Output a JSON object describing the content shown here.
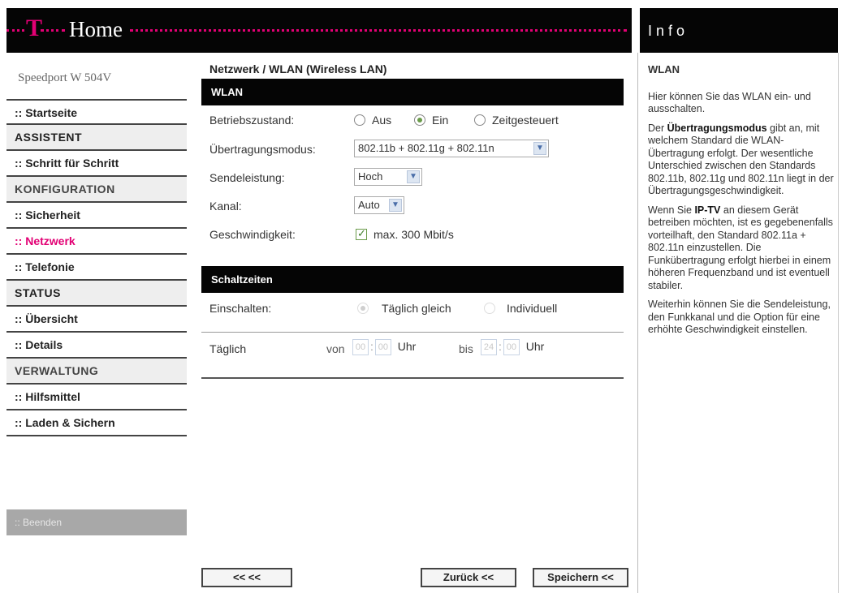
{
  "header": {
    "logo": "T",
    "title": "Home",
    "info_title": "Info"
  },
  "sidebar": {
    "device_name": "Speedport W 504V",
    "items": [
      {
        "label": ":: Startseite",
        "kind": "link"
      },
      {
        "label": "ASSISTENT",
        "kind": "section"
      },
      {
        "label": ":: Schritt für Schritt",
        "kind": "link"
      },
      {
        "label": "KONFIGURATION",
        "kind": "section"
      },
      {
        "label": ":: Sicherheit",
        "kind": "link"
      },
      {
        "label": ":: Netzwerk",
        "kind": "link",
        "active": true
      },
      {
        "label": ":: Telefonie",
        "kind": "link"
      },
      {
        "label": "STATUS",
        "kind": "section"
      },
      {
        "label": ":: Übersicht",
        "kind": "link"
      },
      {
        "label": ":: Details",
        "kind": "link"
      },
      {
        "label": "VERWALTUNG",
        "kind": "section"
      },
      {
        "label": ":: Hilfsmittel",
        "kind": "link"
      },
      {
        "label": ":: Laden & Sichern",
        "kind": "link"
      }
    ],
    "logout_label": ":: Beenden"
  },
  "main": {
    "breadcrumb": "Netzwerk / WLAN (Wireless LAN)",
    "wlan": {
      "section_title": "WLAN",
      "betriebszustand": {
        "label": "Betriebszustand:",
        "options": [
          "Aus",
          "Ein",
          "Zeitgesteuert"
        ],
        "selected": "Ein"
      },
      "uebertragungsmodus": {
        "label": "Übertragungsmodus:",
        "value": "802.11b + 802.11g + 802.11n"
      },
      "sendeleistung": {
        "label": "Sendeleistung:",
        "value": "Hoch"
      },
      "kanal": {
        "label": "Kanal:",
        "value": "Auto"
      },
      "geschwindigkeit": {
        "label": "Geschwindigkeit:",
        "checkbox_label": "max. 300 Mbit/s",
        "checked": true
      }
    },
    "schaltzeiten": {
      "section_title": "Schaltzeiten",
      "einschalten": {
        "label": "Einschalten:",
        "options": [
          "Täglich gleich",
          "Individuell"
        ],
        "selected": "Täglich gleich"
      },
      "taeglich": {
        "label": "Täglich",
        "von_label": "von",
        "von_hour": "00",
        "von_min": "00",
        "uhr_label": "Uhr",
        "bis_label": "bis",
        "bis_hour": "24",
        "bis_min": "00"
      }
    },
    "buttons": {
      "back": "<< <<",
      "zurueck": "Zurück <<",
      "speichern": "Speichern <<"
    }
  },
  "info": {
    "heading": "WLAN",
    "p1": "Hier können Sie das WLAN ein- und ausschalten.",
    "p2_pre": "Der ",
    "p2_bold": "Übertragungsmodus",
    "p2_post": " gibt an, mit welchem Standard die WLAN-Übertragung erfolgt. Der wesentliche Unterschied zwischen den Standards 802.11b, 802.11g und 802.11n liegt in der Übertragungsgeschwindigkeit.",
    "p3_pre": "Wenn Sie ",
    "p3_bold": "IP-TV",
    "p3_post": " an diesem Gerät betreiben möchten, ist es gegebenenfalls vorteilhaft, den Standard 802.11a + 802.11n einzustellen. Die Funkübertragung erfolgt hierbei in einem höheren Frequenzband und ist eventuell stabiler.",
    "p4": "Weiterhin können Sie die Sendeleistung, den Funkkanal und die Option für eine erhöhte Geschwindigkeit einstellen."
  },
  "colors": {
    "magenta": "#e20074",
    "bar": "#050505",
    "radio_green": "#6a9b4a"
  }
}
